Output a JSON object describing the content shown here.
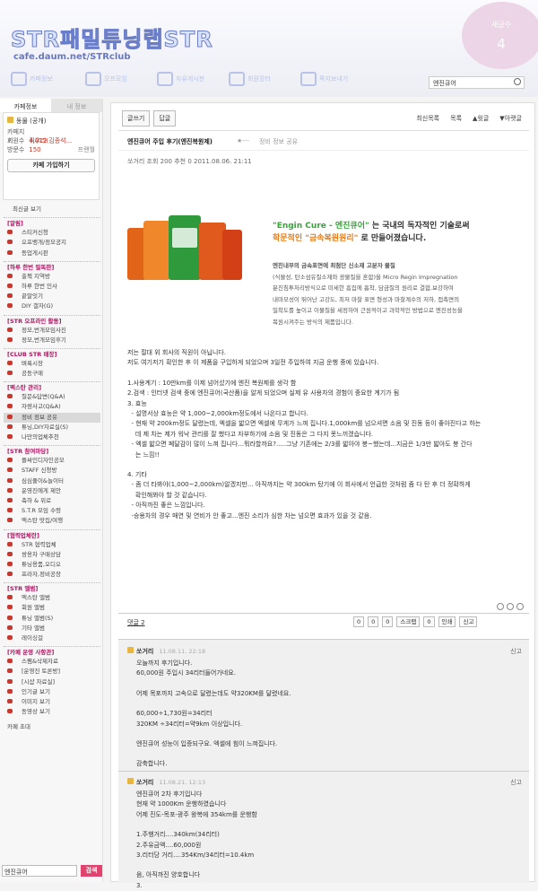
{
  "header": {
    "logo": "STR패밀튜닝랩STR",
    "url": "cafe.daum.net/STRclub",
    "badge_label": "새글수",
    "badge_value": "4",
    "nav": [
      "카페정보",
      "오프모임",
      "자유게시판",
      "회원장터",
      "쪽지보내기"
    ],
    "search_value": "엔진큐어"
  },
  "sidebar": {
    "tab_cafe": "카페정보",
    "tab_my": "내 정보",
    "level": "동물 (공개)",
    "rows": [
      {
        "k": "카페지기",
        "v": "쿼우라(김종석..."
      },
      {
        "k": "회원수",
        "v": "4,012"
      },
      {
        "k": "방문수",
        "v": "150"
      }
    ],
    "rank_label": "프랜월",
    "join": "카페 가입하기",
    "recent": "최신글 보기",
    "groups": [
      {
        "h": "[알림]",
        "items": [
          "스티커신청",
          "오프뱅개/정모공지",
          "등업게시판"
        ]
      },
      {
        "h": "[하루 한번 필독판]",
        "items": [
          "출첵 지역방",
          "하루 한번 인사",
          "끝말잇기",
          "DIY 갤자(G)"
        ]
      },
      {
        "h": "[STR 오프라인 활동]",
        "items": [
          "정모,번개모임사진",
          "정모,번개모임후기"
        ]
      },
      {
        "h": "[CLUB STR 매장]",
        "items": [
          "벼룩시장",
          "공동구매"
        ]
      },
      {
        "h": "[맥스탄 관리]",
        "items": [
          "질문&답변(Q&A)",
          "자량사고(Q&A)",
          "정비 정보 공유",
          "튜닝,DIY자료실(S)",
          "나만의업체추천"
        ]
      },
      {
        "h": "[STR 참여마당]",
        "items": [
          "플싸인디자인공모",
          "STAFF 신청방",
          "심심풀이&놀이터",
          "운영진에게 제안",
          "축하 & 위로",
          "S.T.R 모임 수령",
          "맥스탄 맛집/여행"
        ]
      },
      {
        "h": "[협력업체란]",
        "items": [
          "STR 협력업체",
          "쌍용차 구매상담",
          "튜닝용품,오디오",
          "프라자,정비공장"
        ]
      },
      {
        "h": "[STR 앨범]",
        "items": [
          "맥스탄 앨범",
          "회원 앨범",
          "튜닝 앨범(S)",
          "기타 앨범",
          "레이싱걸"
        ]
      },
      {
        "h": "[카페 운영 사항관]",
        "items": [
          "스팸&삭제자료",
          "[운영진 토론방]",
          "[시샵 자료실]",
          "인기글 보기",
          "이미지 보기",
          "동영상 보기"
        ]
      }
    ],
    "invite": "카페 초대",
    "search_value": "엔진큐어",
    "search_button": "검색"
  },
  "toolbar": {
    "write": "글쓰기",
    "reply": "답글",
    "right": [
      "최신목록",
      "목록",
      "▲윗글",
      "▼아랫글"
    ]
  },
  "post": {
    "title": "엔진큐어 주입 후기(엔진복원제)",
    "stars": "★---",
    "category": "정비 정보 공유",
    "meta": "쏘거리 조회 200    추천 0    2011.08.06. 21:11",
    "ad_title_1": "\"Engin Cure - 엔진큐어\"",
    "ad_title_2": "는 국내의 독자적인 기술로써",
    "ad_title_3": "학문적인 \"금속복원원리\"",
    "ad_title_4": "로 만들어졌습니다.",
    "ad_text": [
      "엔진내부의 금속표면에 최첨단 신소재 고분자 물질",
      "(식물성, 탄소섬유질소재와 광물질을 혼합)을 Micro Regin Impregnation",
      "분진침투처리방식으로 미세한 흠집에 흡착, 담금질의 원리로 결합,보강하여",
      "내마모성이 뛰어난 고강도, 최저 마찰 표면 형성과 마찰계수의 저하, 접촉면의",
      "밀착도를 높이고 이물질을 세정하여 근원적이고 과학적인 방법으로 엔진성능을",
      "복원시켜주는 방식의 제품입니다."
    ],
    "lines": [
      "저는 절대 위 회사의 직원이 아닙니다.",
      "저도 여기저기 확인한 후 이 제품을 구입하게 되었으며 3일전 주입하여 지금 운행 중에 있습니다.",
      "",
      "1.사용계기 : 10만km를 이제 넘어섰기에 엔진 복원제를 생각 함",
      "2.검색 : 인터넷 검색 중에 엔진큐어(국산품)을 알게 되었으며 실제 유 사용자의 경험이 중요한 계기가 됨",
      "3. 효능",
      "  - 설명서상 효능은 약 1,000~2,000km정도에서 나온다고 합니다.",
      "  - 현재 약 200km정도 달렸는데, 엑셀을 밟으면 엑셀에 무게가 느껴 집니다.1,000km를 넘으셔면 소음 및 진동 등이 좋아진다고 하는",
      "    데 제 차는 제가 워낙 관리를 잘 했다고 자부하기에 소음 및 진동은 그 다지 못느끼겠습니다.",
      "  - 엑셀 밟으면 페달감이 많이 느껴 집니다...뭐라할까요?.....그냥 기존에는 2/3를 밟아야 붕~했는데...지금은 1/3만 밟아도 붕 간다",
      "    는 느낌!!",
      "",
      "4. 기타",
      "  - 좀 더 타봐야(1,000~2,000km)알겠지만... 아직까지는 약 300km 탔기에 이 회사에서 언급한 것처럼 좀 다 탄 후 더 정확하게",
      "    확인해봐야 할 것 같습니다.",
      "  - 아직까진 좋은 느낌입니다.",
      "  -승용차의 경우 매연 및 연비가 안 좋고...엔진 소리가 심한 차는 넘으면 효과가 있을 것 같음."
    ],
    "comment_link": "댓글 2",
    "share": [
      "0",
      "0",
      "0",
      "스크랩",
      "0",
      "인쇄",
      "신고"
    ]
  },
  "comments": [
    {
      "name": "쏘거리",
      "date": "11.08.11. 22:18",
      "report": "신고",
      "lines": [
        "오늘까지 후기입니다.",
        "60,000원 주입시 34리터들어가네요.",
        "",
        "어제 목포까지 고속으로 달렸는데도 약320KM를 달렸네요.",
        "",
        "60,000÷1,730원=34리터",
        "320KM ÷34리터=약9km 이상입니다.",
        "",
        "엔진큐어 성능이 입증되구요. 엑셀에 힘이 느껴집니다.",
        "",
        "감축합니다."
      ]
    },
    {
      "name": "쏘거리",
      "date": "11.08.21. 12:13",
      "report": "신고",
      "lines": [
        "엔진큐어 2차 후기입니다",
        "현재 약 1000Km 운행하였습니다",
        "어제 진도-목포-광주 왕복에 354km를 운행함",
        "",
        "1.주행거리....340km(34리터)",
        "2.주유금액....60,000원",
        "3.리터당 거리....354Km/34리터=10.4km",
        "",
        "음, 아직까진 양호합니다",
        "3."
      ]
    }
  ]
}
